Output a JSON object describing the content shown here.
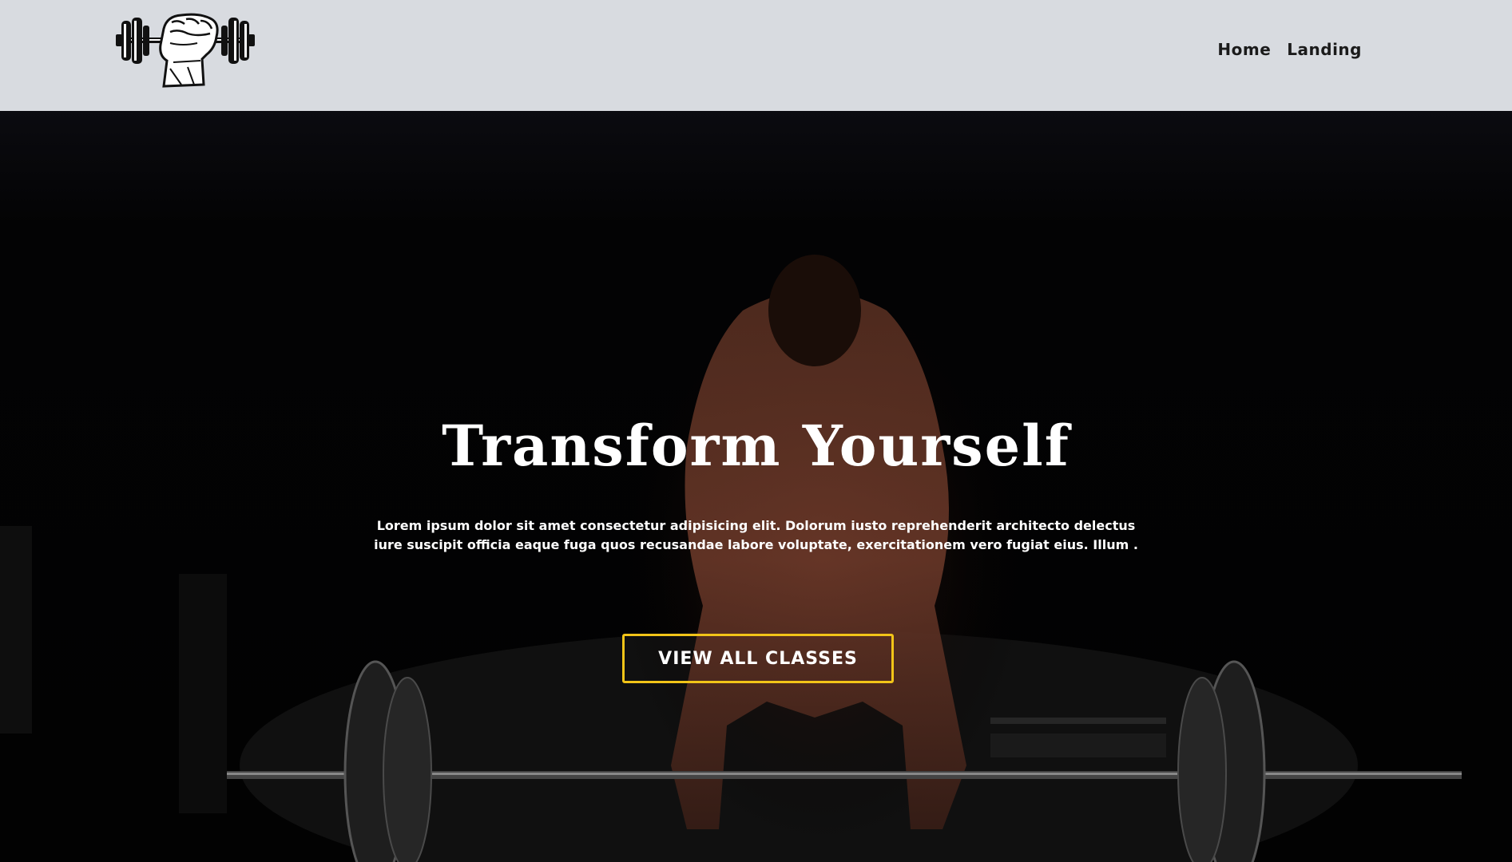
{
  "header": {
    "logo_name": "dumbbell-fist-logo",
    "nav": [
      {
        "label": "Home"
      },
      {
        "label": "Landing"
      }
    ]
  },
  "hero": {
    "title": "Transform Yourself",
    "description": "Lorem ipsum dolor sit amet consectetur adipisicing elit. Dolorum iusto reprehenderit architecto delectus iure suscipit officia eaque fuga quos recusandae labore voluptate, exercitationem vero fugiat eius. Illum .",
    "cta_label": "VIEW ALL CLASSES"
  },
  "colors": {
    "navbar_bg": "#d8dbe0",
    "hero_bg": "#050507",
    "accent": "#f2c418",
    "text_light": "#ffffff",
    "text_dark": "#1b1b1b"
  }
}
